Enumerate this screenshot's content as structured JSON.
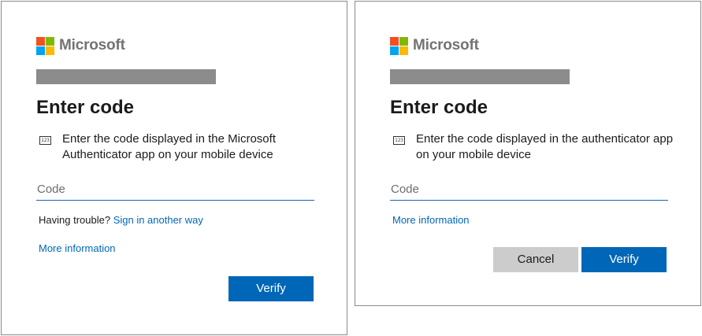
{
  "colors": {
    "logo_red": "#f25022",
    "logo_green": "#7fba00",
    "logo_blue": "#00a4ef",
    "logo_yellow": "#ffb900",
    "primary": "#0067b8",
    "redaction": "#8c8c8c"
  },
  "left_card": {
    "brand": "Microsoft",
    "title": "Enter code",
    "icon_text": "123",
    "description": "Enter the code displayed in the Microsoft Authenticator app on your mobile device",
    "code_placeholder": "Code",
    "trouble_text": "Having trouble?",
    "alt_signin_link": "Sign in another way",
    "more_info_link": "More information",
    "verify_label": "Verify"
  },
  "right_card": {
    "brand": "Microsoft",
    "title": "Enter code",
    "icon_text": "123",
    "description": "Enter the code displayed in the authenticator app on your mobile device",
    "code_placeholder": "Code",
    "more_info_link": "More information",
    "cancel_label": "Cancel",
    "verify_label": "Verify"
  }
}
